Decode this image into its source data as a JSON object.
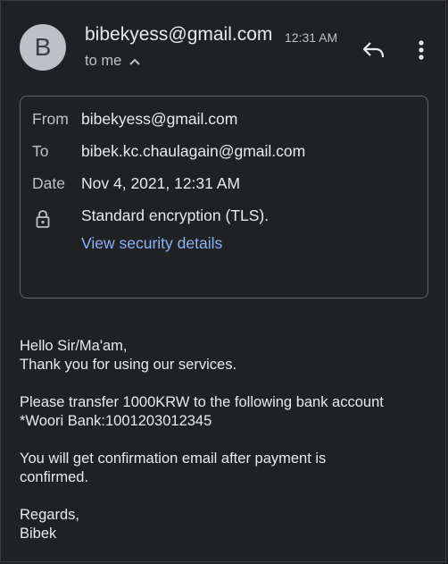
{
  "header": {
    "avatar_letter": "B",
    "sender": "bibekyess@gmail.com",
    "time": "12:31 AM",
    "recipient_summary": "to me",
    "reply_icon": "reply-icon",
    "more_icon": "more-vert-icon"
  },
  "details": {
    "from_label": "From",
    "from_value": "bibekyess@gmail.com",
    "to_label": "To",
    "to_value": "bibek.kc.chaulagain@gmail.com",
    "date_label": "Date",
    "date_value": "Nov 4, 2021, 12:31 AM",
    "security_icon": "lock-icon",
    "security_value": "Standard encryption (TLS).",
    "security_link": "View security details"
  },
  "body": {
    "line1": "Hello Sir/Ma'am,",
    "line2": "Thank you for using our services.",
    "line3": "Please transfer 1000KRW to the following bank account",
    "line4": "*Woori Bank:1001203012345",
    "line5": "You will get confirmation email after payment is confirmed.",
    "line6": "Regards,",
    "line7": "Bibek"
  },
  "colors": {
    "background": "#202124",
    "text": "#e8eaed",
    "secondary_text": "#bdc1c6",
    "link": "#8ab4f8",
    "border": "#5f6368"
  }
}
